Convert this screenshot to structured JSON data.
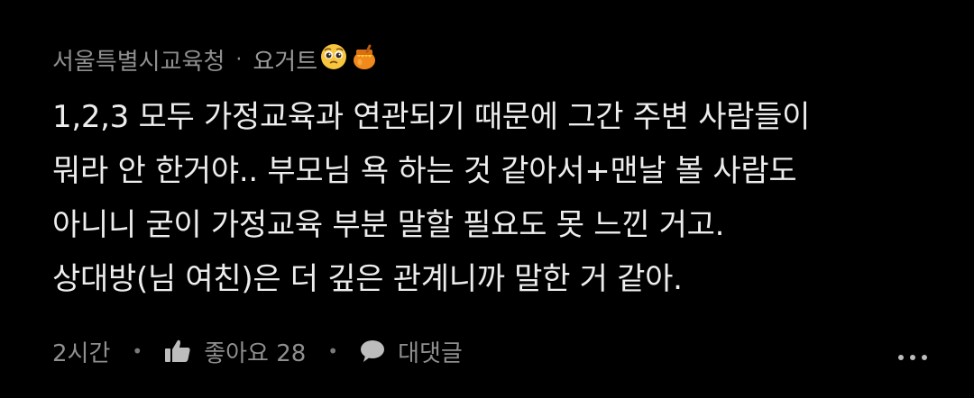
{
  "comment": {
    "author": "서울특별시교육청",
    "separator": "·",
    "nickname": "요거트",
    "emojis": [
      "pleading-face-icon",
      "honey-pot-icon"
    ],
    "body_lines": [
      "1,2,3 모두 가정교육과 연관되기 때문에 그간 주변 사람들이",
      "뭐라 안 한거야.. 부모님 욕 하는 것 같아서+맨날 볼 사람도",
      "아니니 굳이 가정교육 부분 말할 필요도 못 느낀 거고.",
      "상대방(님 여친)은 더 깊은 관계니까 말한 거 같아."
    ],
    "time": "2시간",
    "like_label": "좋아요 28",
    "reply_label": "대댓글"
  },
  "colors": {
    "background": "#000000",
    "text": "#ededed",
    "meta": "#8f8f8f"
  }
}
